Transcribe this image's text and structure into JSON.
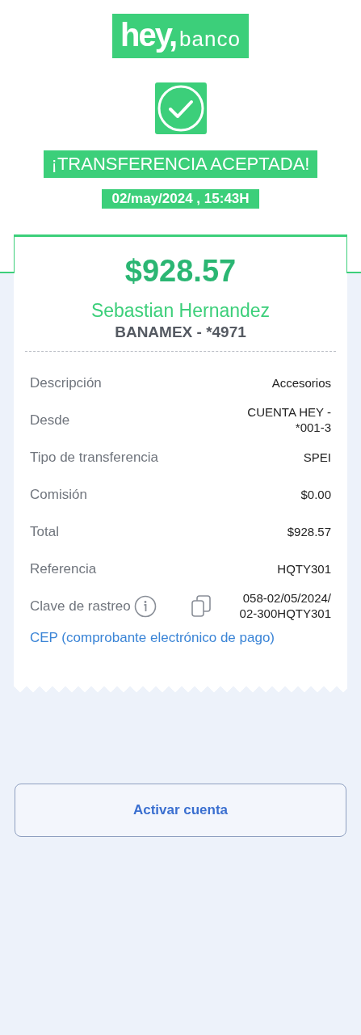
{
  "logo": {
    "word": "hey,",
    "suffix": "banco"
  },
  "status": {
    "title": "¡TRANSFERENCIA ACEPTADA!",
    "datetime": "02/may/2024 , 15:43H"
  },
  "receipt": {
    "amount": "$928.57",
    "recipient": "Sebastian Hernandez",
    "bank": "BANAMEX - *4971",
    "details": [
      {
        "label": "Descripción",
        "value": "Accesorios"
      },
      {
        "label": "Desde",
        "value": "CUENTA HEY - *001-3"
      },
      {
        "label": "Tipo de transferencia",
        "value": "SPEI"
      },
      {
        "label": "Comisión",
        "value": "$0.00"
      },
      {
        "label": "Total",
        "value": "$928.57"
      },
      {
        "label": "Referencia",
        "value": "HQTY301"
      },
      {
        "label": "Clave de rastreo",
        "value": "058-02/05/2024/ 02-300HQTY301",
        "kind": "tracking"
      }
    ],
    "link": "CEP (comprobante electrónico de pago)"
  },
  "button": "Activar cuenta"
}
